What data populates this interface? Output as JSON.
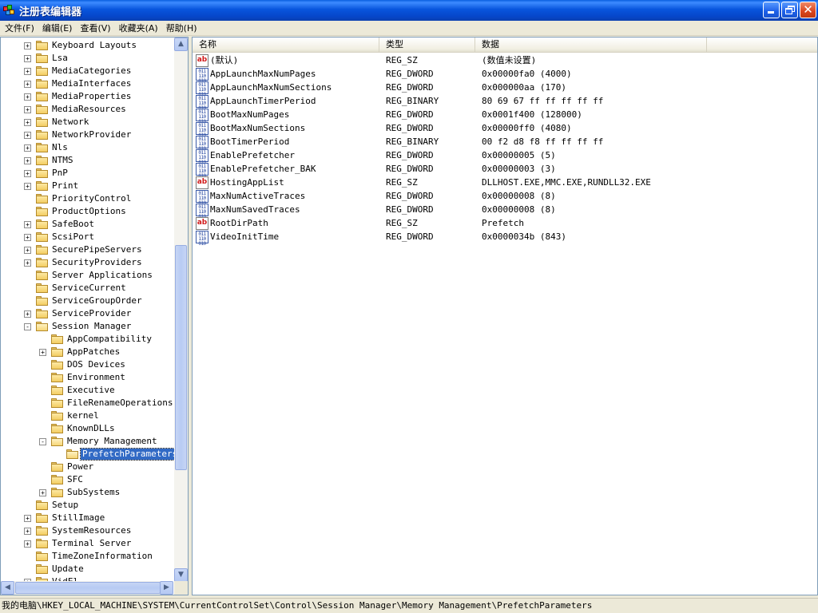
{
  "window": {
    "title": "注册表编辑器"
  },
  "menu": [
    {
      "label": "文件(F)"
    },
    {
      "label": "编辑(E)"
    },
    {
      "label": "查看(V)"
    },
    {
      "label": "收藏夹(A)"
    },
    {
      "label": "帮助(H)"
    }
  ],
  "tree": [
    {
      "label": "Keyboard Layouts",
      "level": 1,
      "expander": "+"
    },
    {
      "label": "Lsa",
      "level": 1,
      "expander": "+"
    },
    {
      "label": "MediaCategories",
      "level": 1,
      "expander": "+"
    },
    {
      "label": "MediaInterfaces",
      "level": 1,
      "expander": "+"
    },
    {
      "label": "MediaProperties",
      "level": 1,
      "expander": "+"
    },
    {
      "label": "MediaResources",
      "level": 1,
      "expander": "+"
    },
    {
      "label": "Network",
      "level": 1,
      "expander": "+"
    },
    {
      "label": "NetworkProvider",
      "level": 1,
      "expander": "+"
    },
    {
      "label": "Nls",
      "level": 1,
      "expander": "+"
    },
    {
      "label": "NTMS",
      "level": 1,
      "expander": "+"
    },
    {
      "label": "PnP",
      "level": 1,
      "expander": "+"
    },
    {
      "label": "Print",
      "level": 1,
      "expander": "+"
    },
    {
      "label": "PriorityControl",
      "level": 1,
      "expander": ""
    },
    {
      "label": "ProductOptions",
      "level": 1,
      "expander": ""
    },
    {
      "label": "SafeBoot",
      "level": 1,
      "expander": "+"
    },
    {
      "label": "ScsiPort",
      "level": 1,
      "expander": "+"
    },
    {
      "label": "SecurePipeServers",
      "level": 1,
      "expander": "+"
    },
    {
      "label": "SecurityProviders",
      "level": 1,
      "expander": "+"
    },
    {
      "label": "Server Applications",
      "level": 1,
      "expander": ""
    },
    {
      "label": "ServiceCurrent",
      "level": 1,
      "expander": ""
    },
    {
      "label": "ServiceGroupOrder",
      "level": 1,
      "expander": ""
    },
    {
      "label": "ServiceProvider",
      "level": 1,
      "expander": "+"
    },
    {
      "label": "Session Manager",
      "level": 1,
      "expander": "-",
      "open": true
    },
    {
      "label": "AppCompatibility",
      "level": 2,
      "expander": ""
    },
    {
      "label": "AppPatches",
      "level": 2,
      "expander": "+"
    },
    {
      "label": "DOS Devices",
      "level": 2,
      "expander": ""
    },
    {
      "label": "Environment",
      "level": 2,
      "expander": ""
    },
    {
      "label": "Executive",
      "level": 2,
      "expander": ""
    },
    {
      "label": "FileRenameOperations",
      "level": 2,
      "expander": ""
    },
    {
      "label": "kernel",
      "level": 2,
      "expander": ""
    },
    {
      "label": "KnownDLLs",
      "level": 2,
      "expander": ""
    },
    {
      "label": "Memory Management",
      "level": 2,
      "expander": "-",
      "open": true
    },
    {
      "label": "PrefetchParameters",
      "level": 3,
      "expander": "",
      "selected": true,
      "open": true
    },
    {
      "label": "Power",
      "level": 2,
      "expander": ""
    },
    {
      "label": "SFC",
      "level": 2,
      "expander": ""
    },
    {
      "label": "SubSystems",
      "level": 2,
      "expander": "+"
    },
    {
      "label": "Setup",
      "level": 1,
      "expander": ""
    },
    {
      "label": "StillImage",
      "level": 1,
      "expander": "+"
    },
    {
      "label": "SystemResources",
      "level": 1,
      "expander": "+"
    },
    {
      "label": "Terminal Server",
      "level": 1,
      "expander": "+"
    },
    {
      "label": "TimeZoneInformation",
      "level": 1,
      "expander": ""
    },
    {
      "label": "Update",
      "level": 1,
      "expander": ""
    },
    {
      "label": "VidEl",
      "level": 1,
      "expander": "+"
    }
  ],
  "list": {
    "columns": [
      "名称",
      "类型",
      "数据"
    ],
    "rows": [
      {
        "name": "(默认)",
        "type": "REG_SZ",
        "data": "(数值未设置)",
        "icon": "string-value-icon"
      },
      {
        "name": "AppLaunchMaxNumPages",
        "type": "REG_DWORD",
        "data": "0x00000fa0 (4000)",
        "icon": "binary-value-icon"
      },
      {
        "name": "AppLaunchMaxNumSections",
        "type": "REG_DWORD",
        "data": "0x000000aa (170)",
        "icon": "binary-value-icon"
      },
      {
        "name": "AppLaunchTimerPeriod",
        "type": "REG_BINARY",
        "data": "80 69 67 ff ff ff ff ff",
        "icon": "binary-value-icon"
      },
      {
        "name": "BootMaxNumPages",
        "type": "REG_DWORD",
        "data": "0x0001f400 (128000)",
        "icon": "binary-value-icon"
      },
      {
        "name": "BootMaxNumSections",
        "type": "REG_DWORD",
        "data": "0x00000ff0 (4080)",
        "icon": "binary-value-icon"
      },
      {
        "name": "BootTimerPeriod",
        "type": "REG_BINARY",
        "data": "00 f2 d8 f8 ff ff ff ff",
        "icon": "binary-value-icon"
      },
      {
        "name": "EnablePrefetcher",
        "type": "REG_DWORD",
        "data": "0x00000005 (5)",
        "icon": "binary-value-icon"
      },
      {
        "name": "EnablePrefetcher_BAK",
        "type": "REG_DWORD",
        "data": "0x00000003 (3)",
        "icon": "binary-value-icon"
      },
      {
        "name": "HostingAppList",
        "type": "REG_SZ",
        "data": "DLLHOST.EXE,MMC.EXE,RUNDLL32.EXE",
        "icon": "string-value-icon"
      },
      {
        "name": "MaxNumActiveTraces",
        "type": "REG_DWORD",
        "data": "0x00000008 (8)",
        "icon": "binary-value-icon"
      },
      {
        "name": "MaxNumSavedTraces",
        "type": "REG_DWORD",
        "data": "0x00000008 (8)",
        "icon": "binary-value-icon"
      },
      {
        "name": "RootDirPath",
        "type": "REG_SZ",
        "data": "Prefetch",
        "icon": "string-value-icon"
      },
      {
        "name": "VideoInitTime",
        "type": "REG_DWORD",
        "data": "0x0000034b (843)",
        "icon": "binary-value-icon"
      }
    ]
  },
  "status": {
    "path": "我的电脑\\HKEY_LOCAL_MACHINE\\SYSTEM\\CurrentControlSet\\Control\\Session Manager\\Memory Management\\PrefetchParameters"
  },
  "icons": {
    "app": "registry-editor-icon",
    "minimize": "minimize-icon",
    "maximize": "restore-icon",
    "close": "close-icon",
    "folder": "folder-icon",
    "scroll_up": "scroll-up-arrow-icon",
    "scroll_down": "scroll-down-arrow-icon",
    "scroll_left": "scroll-left-arrow-icon",
    "scroll_right": "scroll-right-arrow-icon",
    "string_value": "string-value-icon",
    "binary_value": "binary-value-icon"
  },
  "colors": {
    "title_bar": "#0a5fe0",
    "selection": "#316ac5",
    "string_icon_text": "#d01818",
    "chrome": "#ece9d8"
  }
}
